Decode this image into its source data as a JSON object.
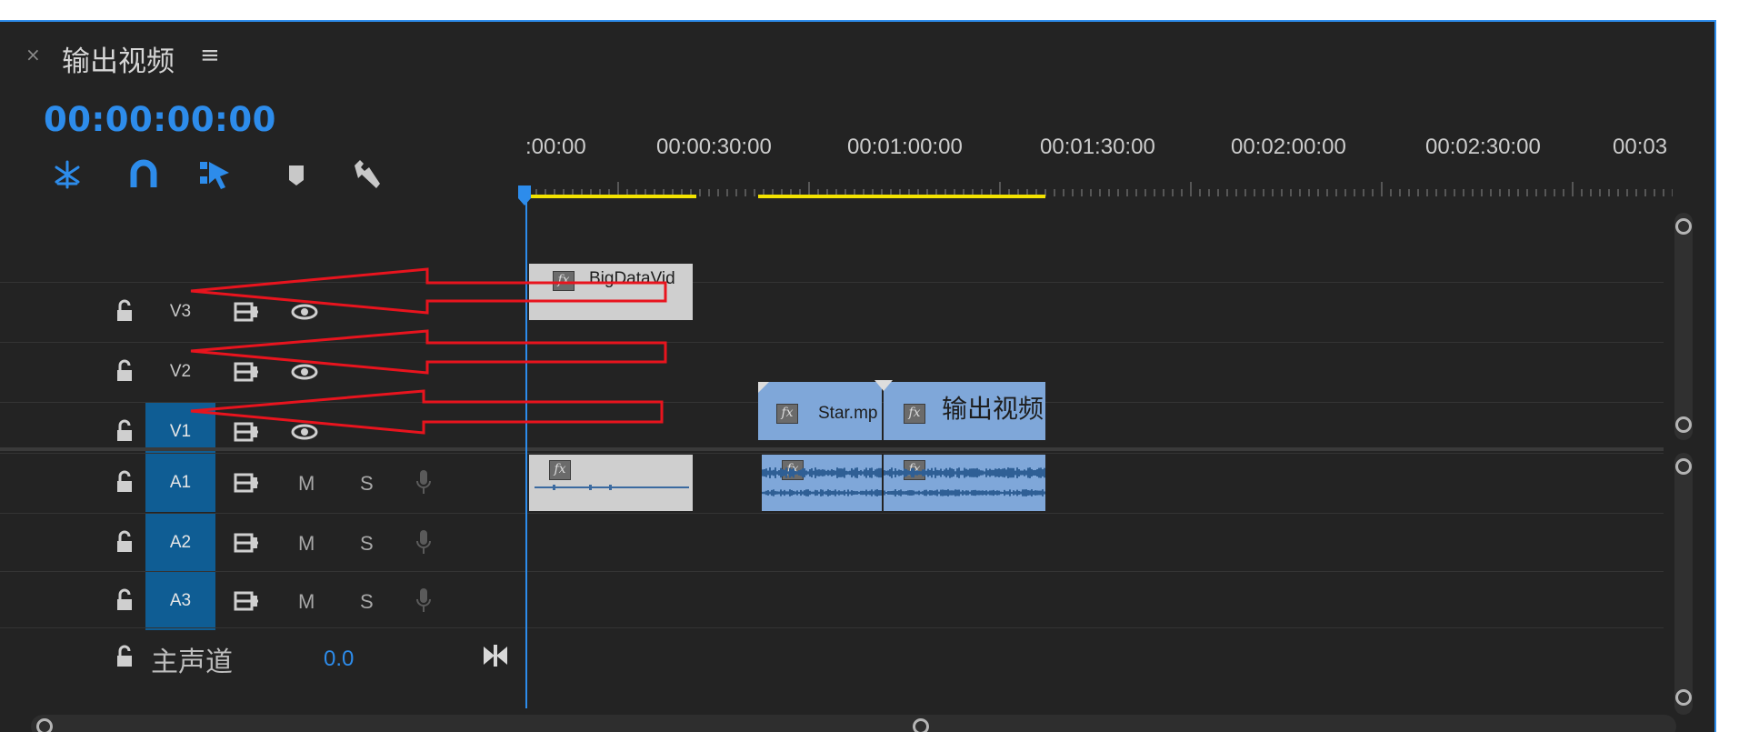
{
  "panel": {
    "close_glyph": "×",
    "title": "输出视频",
    "menu_glyph": "≡",
    "timecode": "00:00:00:00"
  },
  "toolbar": {
    "tools": [
      "snap-sequence-icon",
      "magnet-icon",
      "linked-selection-icon",
      "marker-icon",
      "wrench-icon"
    ]
  },
  "ruler": {
    "labels": [
      ":00:00",
      "00:00:30:00",
      "00:01:00:00",
      "00:01:30:00",
      "00:02:00:00",
      "00:02:30:00",
      "00:03"
    ]
  },
  "tracks": {
    "video": [
      {
        "name": "V3",
        "selected": false
      },
      {
        "name": "V2",
        "selected": false
      },
      {
        "name": "V1",
        "selected": true
      }
    ],
    "audio": [
      {
        "name": "A1",
        "m": "M",
        "s": "S"
      },
      {
        "name": "A2",
        "m": "M",
        "s": "S"
      },
      {
        "name": "A3",
        "m": "M",
        "s": "S"
      }
    ],
    "master": {
      "label": "主声道",
      "value": "0.0"
    }
  },
  "clips": {
    "v3_clip": {
      "fx": "fx",
      "label": "BigDataVid"
    },
    "v1_clip1": {
      "fx": "fx",
      "label": "Star.mp"
    },
    "v1_clip2": {
      "fx": "fx",
      "label": "输出视频"
    },
    "a1_clip1": {
      "fx": "fx"
    },
    "a1_clip2": {
      "fx": "fx"
    },
    "a1_clip3": {
      "fx": "fx"
    }
  },
  "colors": {
    "accent": "#2d8ceb",
    "clip_blue": "#7fa7d9",
    "clip_gray": "#cfcfcf",
    "arrow_red": "#e8141e",
    "workbar_yellow": "#f2e200"
  }
}
